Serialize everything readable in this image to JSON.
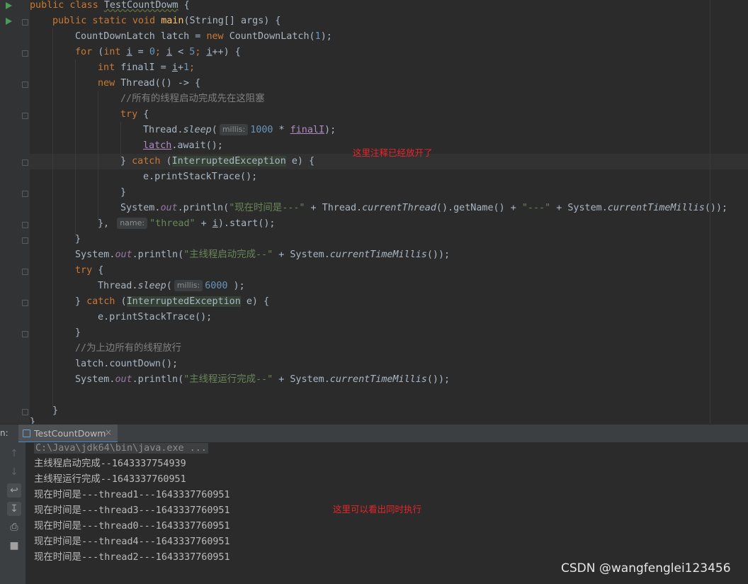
{
  "editor": {
    "lines": {
      "l1": {
        "kw": "public class ",
        "name": "TestCountDowm",
        "rest": " {"
      },
      "l2": {
        "kw": "public static void ",
        "method": "main",
        "rest": "(String[] args) {"
      },
      "l3": {
        "a": "CountDownLatch latch = ",
        "kw": "new ",
        "b": "CountDownLatch(",
        "num": "1",
        "c": ");"
      },
      "l4": {
        "kw1": "for ",
        "a": "(",
        "kw2": "int ",
        "v1": "i",
        "b": " = ",
        "n1": "0",
        "c": "; ",
        "v2": "i",
        "d": " < ",
        "n2": "5",
        "e": "; ",
        "v3": "i",
        "f": "++) {"
      },
      "l5": {
        "kw": "int ",
        "a": "finalI = ",
        "v": "i",
        "b": "+",
        "num": "1",
        "c": ";"
      },
      "l6": {
        "kw": "new ",
        "a": "Thread(() -> {"
      },
      "l7": {
        "comment": "//所有的线程启动完成先在这阻塞"
      },
      "l8": {
        "kw": "try ",
        "a": "{"
      },
      "l9": {
        "a": "Thread.",
        "m": "sleep",
        "b": "(",
        "hint": "millis:",
        "num": "1000",
        "c": " * ",
        "v": "finalI",
        "d": ");"
      },
      "l10": {
        "v": "latch",
        "a": ".await();"
      },
      "l11": {
        "a": "} ",
        "kw": "catch ",
        "b": "(",
        "exc": "InterruptedException",
        "c": " e) {"
      },
      "l12": {
        "a": "e.printStackTrace();"
      },
      "l13": {
        "a": "}"
      },
      "l14": {
        "a": "System.",
        "f": "out",
        "b": ".println(",
        "s1": "\"现在时间是---\"",
        "c": " + Thread.",
        "m1": "currentThread",
        "d": "().getName() + ",
        "s2": "\"---\"",
        "e": " + System.",
        "m2": "currentTimeMillis",
        "g": "());"
      },
      "l15": {
        "a": "}, ",
        "hint": "name:",
        "s": "\"thread\"",
        "b": " + ",
        "v": "i",
        "c": ").start();"
      },
      "l16": {
        "a": "}"
      },
      "l17": {
        "a": "System.",
        "f": "out",
        "b": ".println(",
        "s": "\"主线程启动完成--\"",
        "c": " + System.",
        "m": "currentTimeMillis",
        "d": "());"
      },
      "l18": {
        "kw": "try ",
        "a": "{"
      },
      "l19": {
        "a": "Thread.",
        "m": "sleep",
        "b": "(",
        "hint": "millis:",
        "num": "6000",
        "c": " );"
      },
      "l20": {
        "a": "} ",
        "kw": "catch ",
        "b": "(",
        "exc": "InterruptedException",
        "c": " e) {"
      },
      "l21": {
        "a": "e.printStackTrace();"
      },
      "l22": {
        "a": "}"
      },
      "l23": {
        "comment": "//为上边所有的线程放行"
      },
      "l24": {
        "a": "latch.countDown();"
      },
      "l25": {
        "a": "System.",
        "f": "out",
        "b": ".println(",
        "s": "\"主线程运行完成--\"",
        "c": " + System.",
        "m": "currentTimeMillis",
        "d": "());"
      },
      "l26": {
        "a": "}"
      },
      "l27": {
        "a": "}"
      }
    },
    "annotation_1": "这里注释已经放开了"
  },
  "run_window": {
    "prefix": "n:",
    "tab_label": "TestCountDowm",
    "tab_close": "×",
    "toolbar_icons": [
      "up-arrow-icon",
      "down-arrow-icon",
      "soft-wrap-icon",
      "scroll-to-end-icon",
      "print-icon",
      "trash-icon"
    ],
    "output": [
      "C:\\Java\\jdk64\\bin\\java.exe ...",
      "主线程启动完成--1643337754939",
      "主线程运行完成--1643337760951",
      "现在时间是---thread1---1643337760951",
      "现在时间是---thread3---1643337760951",
      "现在时间是---thread0---1643337760951",
      "现在时间是---thread4---1643337760951",
      "现在时间是---thread2---1643337760951"
    ],
    "annotation_2": "这里可以看出同时执行"
  },
  "watermark": "CSDN @wangfenglei123456",
  "colors": {
    "background": "#2b2b2b",
    "keyword": "#cc7832",
    "string": "#6a8759",
    "number": "#6897bb",
    "method_decl": "#ffc66d",
    "annotation_red": "#e8262b"
  }
}
